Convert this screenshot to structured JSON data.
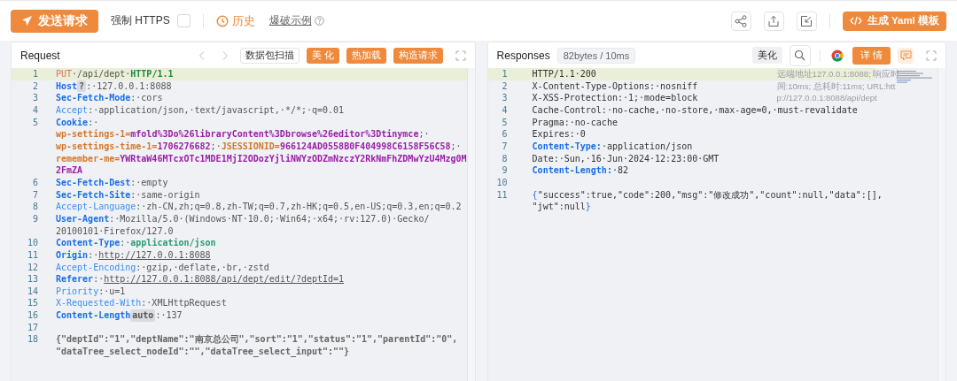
{
  "toolbar": {
    "send_button": {
      "label": "发送请求"
    },
    "force_https": {
      "label": "强制 HTTPS",
      "checked": false
    },
    "history": {
      "label": "历史"
    },
    "burst_example": {
      "label": "爆破示例"
    },
    "yaml_button": {
      "label": "生成 Yaml 模板"
    }
  },
  "request": {
    "title": "Request",
    "scan_button": {
      "label": "数据包扫描"
    },
    "buttons": [
      {
        "label": "美 化"
      },
      {
        "label": "热加载"
      },
      {
        "label": "构造请求"
      }
    ],
    "lines": [
      {
        "number": "1",
        "highlighted": true,
        "wrapped_rows": [
          {
            "segments": [
              {
                "kind": "method",
                "text": "PUT"
              },
              {
                "kind": "plain",
                "text": "·/api/dept·"
              },
              {
                "kind": "version",
                "text": "HTTP/1.1"
              }
            ]
          }
        ]
      },
      {
        "number": "2",
        "highlighted": false,
        "wrapped_rows": [
          {
            "segments": [
              {
                "kind": "key-strong",
                "text": "Host"
              },
              {
                "kind": "badge",
                "text": "?"
              },
              {
                "kind": "plain",
                "text": ":·127.0.0.1:8088"
              }
            ]
          }
        ]
      },
      {
        "number": "3",
        "highlighted": false,
        "wrapped_rows": [
          {
            "segments": [
              {
                "kind": "key-strong",
                "text": "Sec-Fetch-Mode"
              },
              {
                "kind": "plain",
                "text": ":·cors"
              }
            ]
          }
        ]
      },
      {
        "number": "4",
        "highlighted": false,
        "wrapped_rows": [
          {
            "segments": [
              {
                "kind": "key",
                "text": "Accept"
              },
              {
                "kind": "plain",
                "text": ":·application/json,·text/javascript,·*/*;·q=0.01"
              }
            ]
          }
        ]
      },
      {
        "number": "5",
        "highlighted": false,
        "wrapped_rows": [
          {
            "segments": [
              {
                "kind": "key-strong",
                "text": "Cookie"
              },
              {
                "kind": "plain",
                "text": ":·"
              }
            ]
          },
          {
            "segments": [
              {
                "kind": "cookie-name",
                "text": "wp-settings-1="
              },
              {
                "kind": "cookie-value",
                "text": "mfold%3Do%26libraryContent%3Dbrowse%26editor%3Dtinymce"
              },
              {
                "kind": "plain",
                "text": ";·"
              }
            ]
          },
          {
            "segments": [
              {
                "kind": "cookie-name",
                "text": "wp-settings-time-1="
              },
              {
                "kind": "cookie-value",
                "text": "1706276682"
              },
              {
                "kind": "plain",
                "text": ";·"
              },
              {
                "kind": "cookie-name",
                "text": "JSESSIONID="
              },
              {
                "kind": "cookie-value",
                "text": "966124AD0558B0F404998C6158F56C58"
              },
              {
                "kind": "plain",
                "text": ";·"
              }
            ]
          },
          {
            "segments": [
              {
                "kind": "cookie-name",
                "text": "remember-me="
              },
              {
                "kind": "cookie-value",
                "text": "YWRtaW46MTcxOTc1MDE1MjI2ODozYjliNWYzODZmNzczY2RkNmFhZDMwYzU4Mzg0M"
              }
            ]
          },
          {
            "segments": [
              {
                "kind": "cookie-value",
                "text": "2FmZA"
              }
            ]
          }
        ]
      },
      {
        "number": "6",
        "highlighted": false,
        "wrapped_rows": [
          {
            "segments": [
              {
                "kind": "key-strong",
                "text": "Sec-Fetch-Dest"
              },
              {
                "kind": "plain",
                "text": ":·empty"
              }
            ]
          }
        ]
      },
      {
        "number": "7",
        "highlighted": false,
        "wrapped_rows": [
          {
            "segments": [
              {
                "kind": "key-strong",
                "text": "Sec-Fetch-Site"
              },
              {
                "kind": "plain",
                "text": ":·same-origin"
              }
            ]
          }
        ]
      },
      {
        "number": "8",
        "highlighted": false,
        "wrapped_rows": [
          {
            "segments": [
              {
                "kind": "key",
                "text": "Accept-Language"
              },
              {
                "kind": "plain",
                "text": ":·zh-CN,zh;q=0.8,zh-TW;q=0.7,zh-HK;q=0.5,en-US;q=0.3,en;q=0.2"
              }
            ]
          }
        ]
      },
      {
        "number": "9",
        "highlighted": false,
        "wrapped_rows": [
          {
            "segments": [
              {
                "kind": "key-strong",
                "text": "User-Agent"
              },
              {
                "kind": "plain",
                "text": ":·Mozilla/5.0·(Windows·NT·10.0;·Win64;·x64;·rv:127.0)·Gecko/"
              }
            ]
          },
          {
            "segments": [
              {
                "kind": "plain",
                "text": "20100101·Firefox/127.0"
              }
            ]
          }
        ]
      },
      {
        "number": "10",
        "highlighted": false,
        "wrapped_rows": [
          {
            "segments": [
              {
                "kind": "key-strong",
                "text": "Content-Type"
              },
              {
                "kind": "plain",
                "text": ":·"
              },
              {
                "kind": "value-strong",
                "text": "application/json"
              }
            ]
          }
        ]
      },
      {
        "number": "11",
        "highlighted": false,
        "wrapped_rows": [
          {
            "segments": [
              {
                "kind": "key-strong",
                "text": "Origin"
              },
              {
                "kind": "plain",
                "text": ":·"
              },
              {
                "kind": "url",
                "text": "http://127.0.0.1:8088"
              }
            ]
          }
        ]
      },
      {
        "number": "12",
        "highlighted": false,
        "wrapped_rows": [
          {
            "segments": [
              {
                "kind": "key",
                "text": "Accept-Encoding"
              },
              {
                "kind": "plain",
                "text": ":·gzip,·deflate,·br,·zstd"
              }
            ]
          }
        ]
      },
      {
        "number": "13",
        "highlighted": false,
        "wrapped_rows": [
          {
            "segments": [
              {
                "kind": "key-strong",
                "text": "Referer"
              },
              {
                "kind": "plain",
                "text": ":·"
              },
              {
                "kind": "url",
                "text": "http://127.0.0.1:8088/api/dept/edit/?deptId=1"
              }
            ]
          }
        ]
      },
      {
        "number": "14",
        "highlighted": false,
        "wrapped_rows": [
          {
            "segments": [
              {
                "kind": "key",
                "text": "Priority"
              },
              {
                "kind": "plain",
                "text": ":·u=1"
              }
            ]
          }
        ]
      },
      {
        "number": "15",
        "highlighted": false,
        "wrapped_rows": [
          {
            "segments": [
              {
                "kind": "key",
                "text": "X-Requested-With"
              },
              {
                "kind": "plain",
                "text": ":·XMLHttpRequest"
              }
            ]
          }
        ]
      },
      {
        "number": "16",
        "highlighted": false,
        "wrapped_rows": [
          {
            "segments": [
              {
                "kind": "key-strong",
                "text": "Content-Length"
              },
              {
                "kind": "badge",
                "text": "auto"
              },
              {
                "kind": "plain",
                "text": ":·137"
              }
            ]
          }
        ]
      },
      {
        "number": "17",
        "highlighted": false,
        "wrapped_rows": [
          {}
        ]
      },
      {
        "number": "18",
        "highlighted": false,
        "wrapped_rows": [
          {
            "segments": [
              {
                "kind": "body",
                "text": "{\"deptId\":\"1\",\"deptName\":\"南京总公司\",\"sort\":\"1\",\"status\":\"1\",\"parentId\":\"0\","
              }
            ]
          },
          {
            "segments": [
              {
                "kind": "body",
                "text": "\"dataTree_select_nodeId\":\"\",\"dataTree_select_input\":\"\"}"
              }
            ]
          }
        ]
      }
    ]
  },
  "response": {
    "title": "Responses",
    "stats": "82bytes / 10ms",
    "beautify_button": {
      "label": "美化"
    },
    "detail_button": {
      "label": "详 情"
    },
    "info_note": "远端地址127.0.0.1:8088; 响应时间:10ms; 总耗时:11ms; URL:http://127.0.0.1:8088/api/dept",
    "lines": [
      {
        "number": "1",
        "highlighted": true,
        "wrapped_rows": [
          {
            "segments": [
              {
                "kind": "text",
                "text": "HTTP/1.1·200"
              }
            ]
          }
        ]
      },
      {
        "number": "2",
        "highlighted": false,
        "wrapped_rows": [
          {
            "segments": [
              {
                "kind": "text",
                "text": "X-Content-Type-Options:·nosniff"
              }
            ]
          }
        ]
      },
      {
        "number": "3",
        "highlighted": false,
        "wrapped_rows": [
          {
            "segments": [
              {
                "kind": "text",
                "text": "X-XSS-Protection:·1;·mode=block"
              }
            ]
          }
        ]
      },
      {
        "number": "4",
        "highlighted": false,
        "wrapped_rows": [
          {
            "segments": [
              {
                "kind": "text",
                "text": "Cache-Control:·no-cache,·no-store,·max-age=0,·must-revalidate"
              }
            ]
          }
        ]
      },
      {
        "number": "5",
        "highlighted": false,
        "wrapped_rows": [
          {
            "segments": [
              {
                "kind": "text",
                "text": "Pragma:·no-cache"
              }
            ]
          }
        ]
      },
      {
        "number": "6",
        "highlighted": false,
        "wrapped_rows": [
          {
            "segments": [
              {
                "kind": "text",
                "text": "Expires:·0"
              }
            ]
          }
        ]
      },
      {
        "number": "7",
        "highlighted": false,
        "wrapped_rows": [
          {
            "segments": [
              {
                "kind": "key-strong",
                "text": "Content-Type:"
              },
              {
                "kind": "text",
                "text": "·application/json"
              }
            ]
          }
        ]
      },
      {
        "number": "8",
        "highlighted": false,
        "wrapped_rows": [
          {
            "segments": [
              {
                "kind": "text",
                "text": "Date:·Sun,·16·Jun·2024·12:23:00·GMT"
              }
            ]
          }
        ]
      },
      {
        "number": "9",
        "highlighted": false,
        "wrapped_rows": [
          {
            "segments": [
              {
                "kind": "key-strong",
                "text": "Content-Length:"
              },
              {
                "kind": "text",
                "text": "·82"
              }
            ]
          }
        ]
      },
      {
        "number": "10",
        "highlighted": false,
        "wrapped_rows": [
          {}
        ]
      },
      {
        "number": "11",
        "highlighted": false,
        "wrapped_rows": [
          {
            "segments": [
              {
                "kind": "brace",
                "text": "{"
              },
              {
                "kind": "text",
                "text": "\"success\":true,\"code\":200,\"msg\":\"修改成功\",\"count\":null,\"data\":[],"
              }
            ]
          },
          {
            "segments": [
              {
                "kind": "text",
                "text": "\"jwt\":null"
              },
              {
                "kind": "brace",
                "text": "}"
              }
            ]
          }
        ]
      }
    ]
  }
}
